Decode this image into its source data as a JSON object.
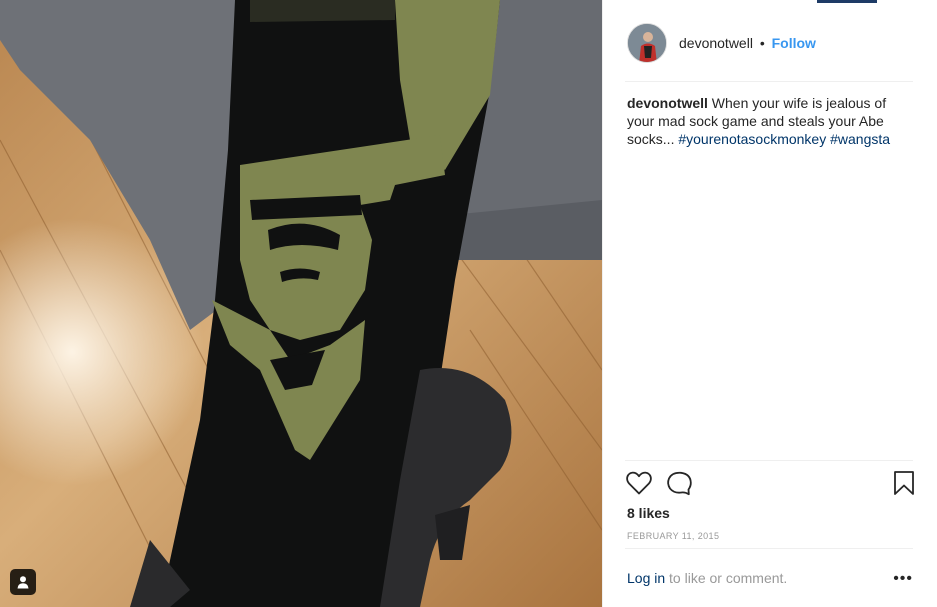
{
  "post": {
    "username": "devonotwell",
    "separator": "•",
    "follow_label": "Follow",
    "caption_user": "devonotwell",
    "caption_text": " When your wife is jealous of your mad sock game and steals your Abe socks... ",
    "hashtags": [
      "#yourenotasockmonkey",
      "#wangsta"
    ],
    "likes": "8 likes",
    "date": "FEBRUARY 11, 2015",
    "login_link": "Log in",
    "login_rest": " to like or comment.",
    "more": "•••"
  },
  "icons": {
    "like": "heart-icon",
    "comment": "comment-bubble-icon",
    "save": "bookmark-icon",
    "tag": "user-tag-icon",
    "more": "more-options-icon"
  },
  "colors": {
    "link": "#3897f0",
    "hashtag": "#003569",
    "muted": "#999999",
    "sock": "#0f1010",
    "sock_print": "#7f8650",
    "floor": "#c79a64",
    "trousers": "#6c6f75"
  }
}
